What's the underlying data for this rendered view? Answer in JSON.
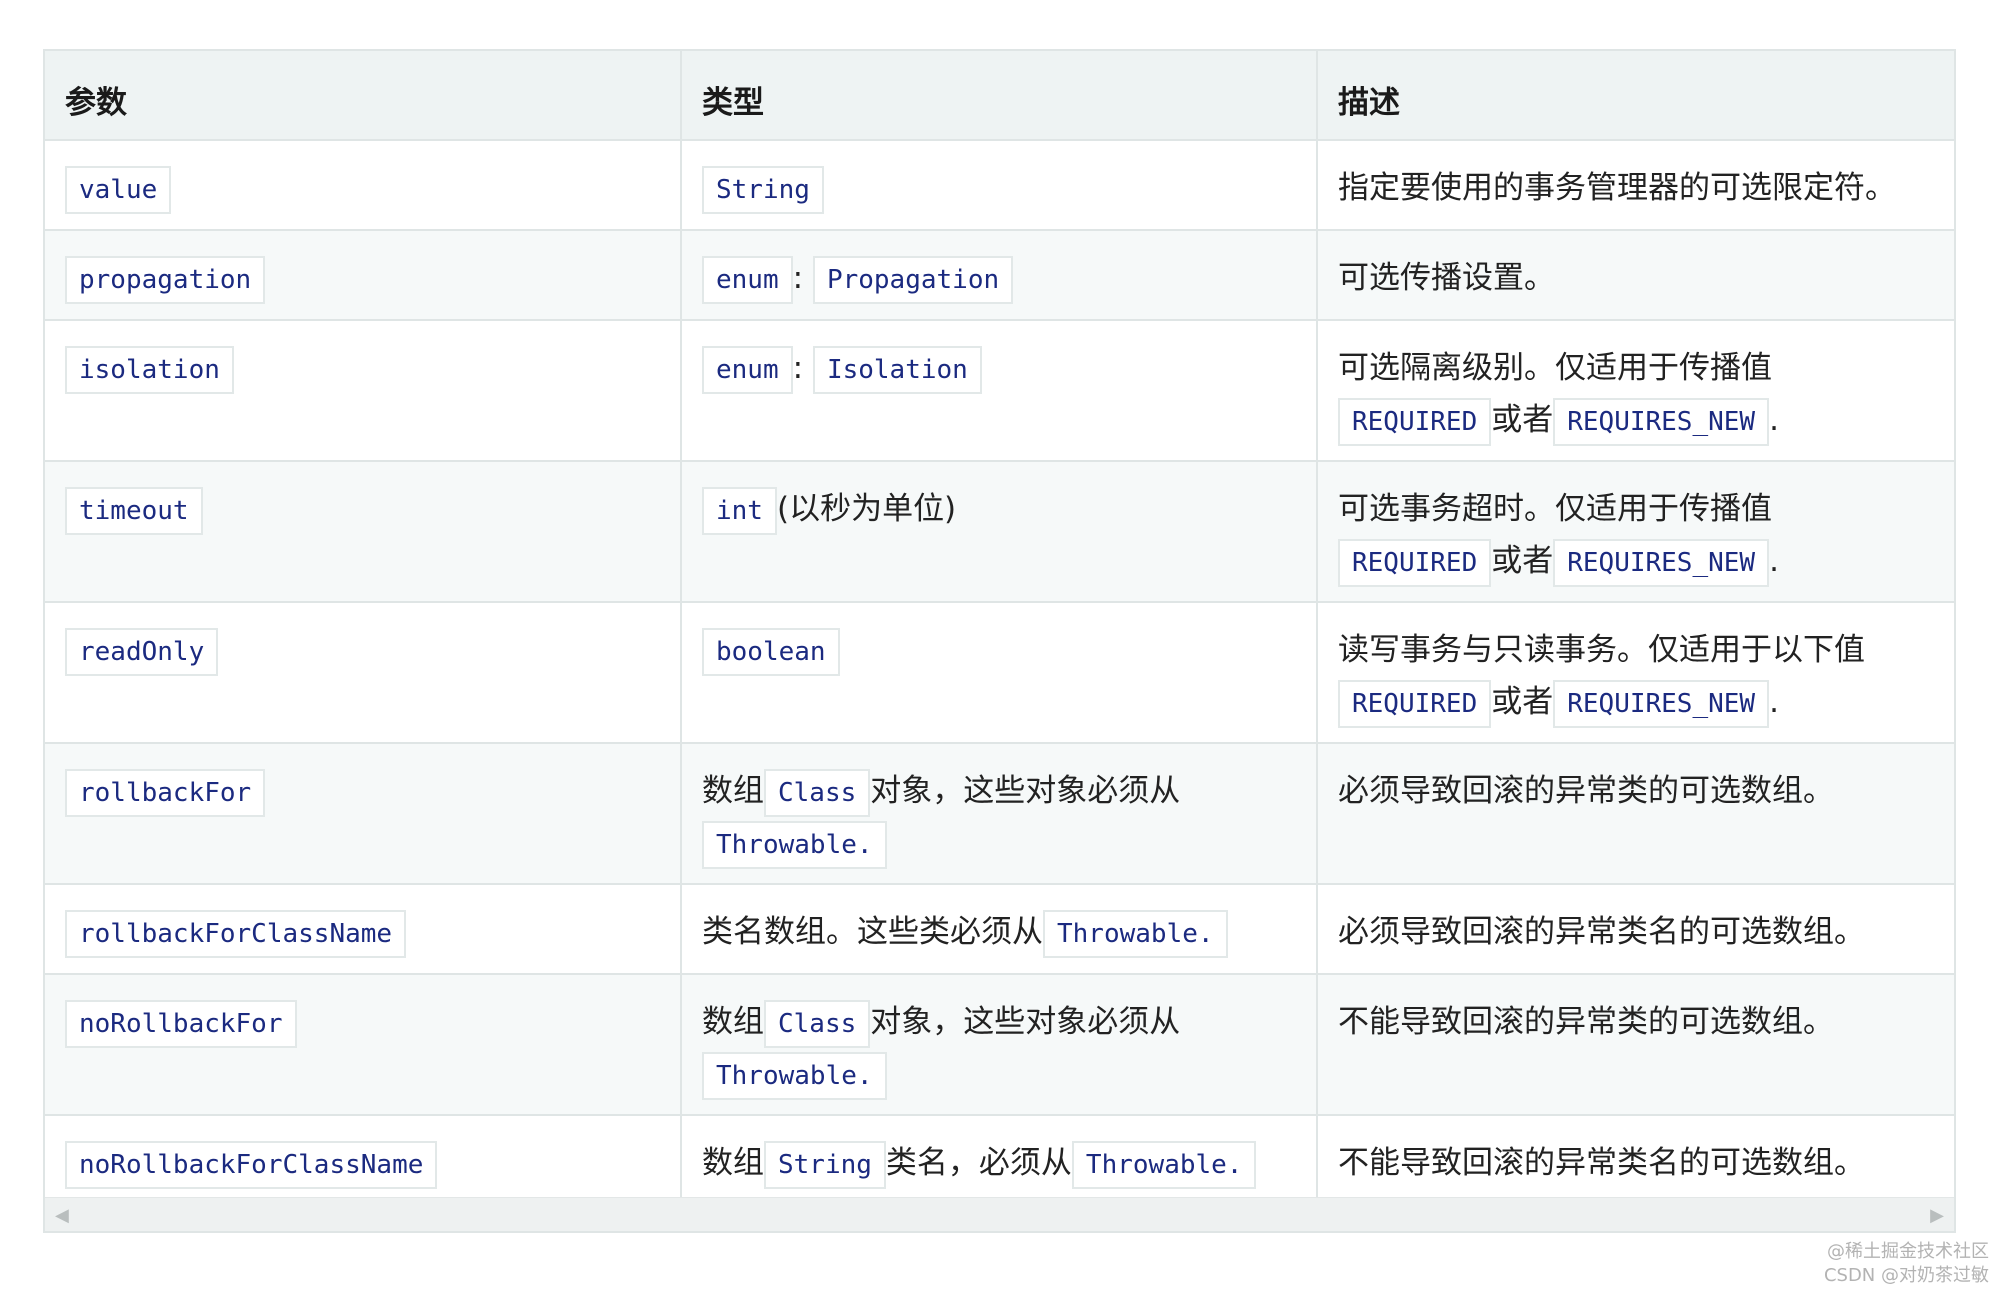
{
  "table": {
    "headers": [
      "参数",
      "类型",
      "描述"
    ],
    "rows": [
      {
        "param": "value",
        "type": [
          {
            "code": "String"
          }
        ],
        "desc": [
          {
            "text": "指定要使用的事务管理器的可选限定符。"
          }
        ]
      },
      {
        "param": "propagation",
        "type": [
          {
            "code": "enum"
          },
          {
            "text": ": "
          },
          {
            "code": "Propagation"
          }
        ],
        "desc": [
          {
            "text": "可选传播设置。"
          }
        ]
      },
      {
        "param": "isolation",
        "type": [
          {
            "code": "enum"
          },
          {
            "text": ": "
          },
          {
            "code": "Isolation"
          }
        ],
        "desc": [
          {
            "text": "可选隔离级别。仅适用于传播值"
          },
          {
            "br": true
          },
          {
            "code": "REQUIRED"
          },
          {
            "text": "或者"
          },
          {
            "code": "REQUIRES_NEW"
          },
          {
            "text": "."
          }
        ]
      },
      {
        "param": "timeout",
        "type": [
          {
            "code": "int"
          },
          {
            "text": "(以秒为单位)"
          }
        ],
        "desc": [
          {
            "text": "可选事务超时。仅适用于传播值"
          },
          {
            "br": true
          },
          {
            "code": "REQUIRED"
          },
          {
            "text": "或者"
          },
          {
            "code": "REQUIRES_NEW"
          },
          {
            "text": "."
          }
        ]
      },
      {
        "param": "readOnly",
        "type": [
          {
            "code": "boolean"
          }
        ],
        "desc": [
          {
            "text": "读写事务与只读事务。仅适用于以下值"
          },
          {
            "br": true
          },
          {
            "code": "REQUIRED"
          },
          {
            "text": "或者"
          },
          {
            "code": "REQUIRES_NEW"
          },
          {
            "text": "."
          }
        ]
      },
      {
        "param": "rollbackFor",
        "type": [
          {
            "text": "数组"
          },
          {
            "code": "Class"
          },
          {
            "text": "对象，这些对象必须从"
          },
          {
            "br": true
          },
          {
            "code": "Throwable."
          }
        ],
        "desc": [
          {
            "text": "必须导致回滚的异常类的可选数组。"
          }
        ]
      },
      {
        "param": "rollbackForClassName",
        "type": [
          {
            "text": "类名数组。这些类必须从"
          },
          {
            "code": "Throwable."
          }
        ],
        "desc": [
          {
            "text": "必须导致回滚的异常类名的可选数组。"
          }
        ]
      },
      {
        "param": "noRollbackFor",
        "type": [
          {
            "text": "数组"
          },
          {
            "code": "Class"
          },
          {
            "text": "对象，这些对象必须从"
          },
          {
            "br": true
          },
          {
            "code": "Throwable."
          }
        ],
        "desc": [
          {
            "text": "不能导致回滚的异常类的可选数组。"
          }
        ]
      },
      {
        "param": "noRollbackForClassName",
        "type": [
          {
            "text": "数组"
          },
          {
            "code": "String"
          },
          {
            "text": "类名，必须从"
          },
          {
            "code": "Throwable."
          }
        ],
        "desc": [
          {
            "text": "不能导致回滚的异常类名的可选数组。"
          }
        ]
      }
    ]
  },
  "scrollbar": {
    "left_arrow": "◀",
    "right_arrow": "▶"
  },
  "watermark": {
    "line1": "@稀土掘金技术社区",
    "line2": "CSDN @对奶茶过敏"
  }
}
